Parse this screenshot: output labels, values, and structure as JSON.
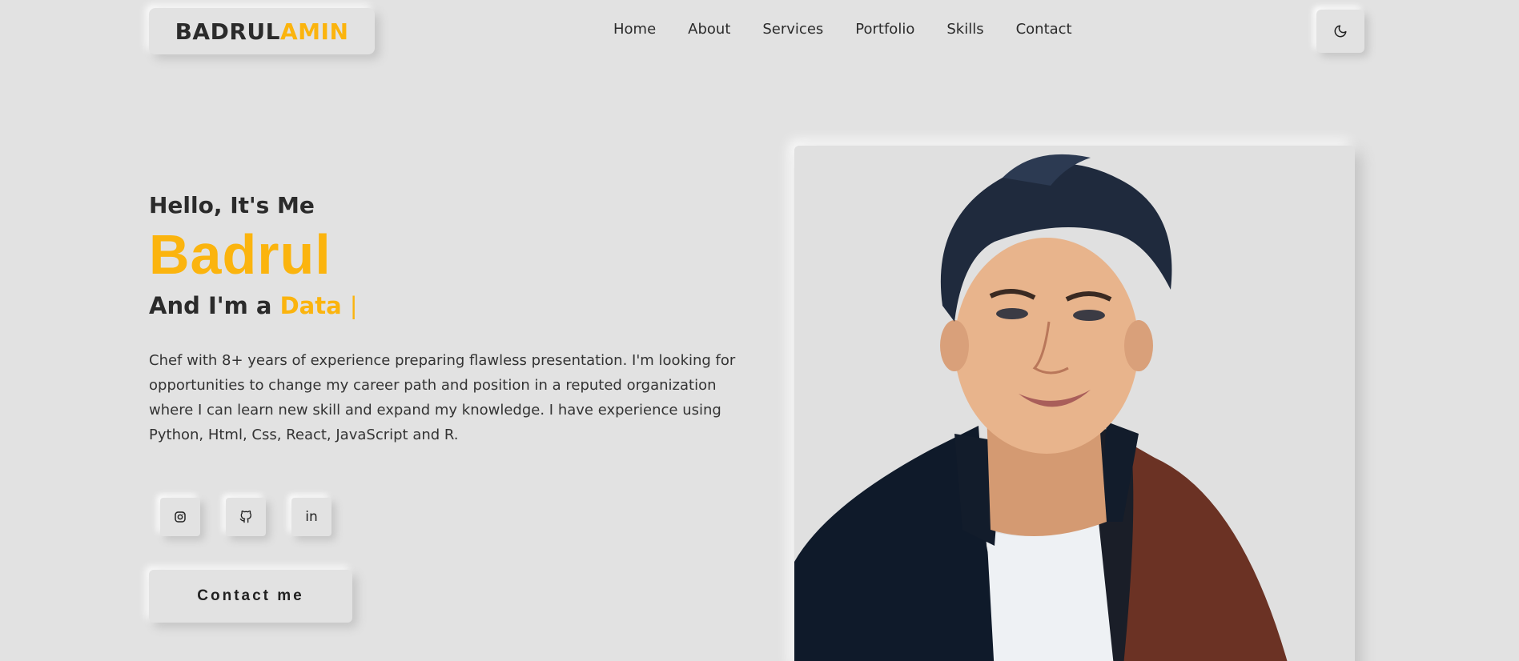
{
  "header": {
    "logo_first": "BADRUL",
    "logo_second": "AMIN",
    "nav": [
      "Home",
      "About",
      "Services",
      "Portfolio",
      "Skills",
      "Contact"
    ],
    "theme_icon": "moon-icon"
  },
  "hero": {
    "greeting": "Hello, It's Me",
    "name": "Badrul",
    "role_prefix": "And I'm a",
    "role_typed": "Data",
    "role_cursor": "|",
    "description": "Chef with 8+ years of experience preparing flawless presentation. I'm looking for opportunities to change my career path and position in a reputed organization where I can learn new skill and expand my knowledge. I have experience using Python, Html, Css, React, JavaScript and R.",
    "social_icons": [
      "instagram-icon",
      "github-icon",
      "linkedin-icon"
    ],
    "linkedin_text": "in",
    "contact_button": "Contact me"
  },
  "colors": {
    "background": "#e2e2e2",
    "accent": "#fbb40e",
    "text": "#2b2b2b"
  }
}
